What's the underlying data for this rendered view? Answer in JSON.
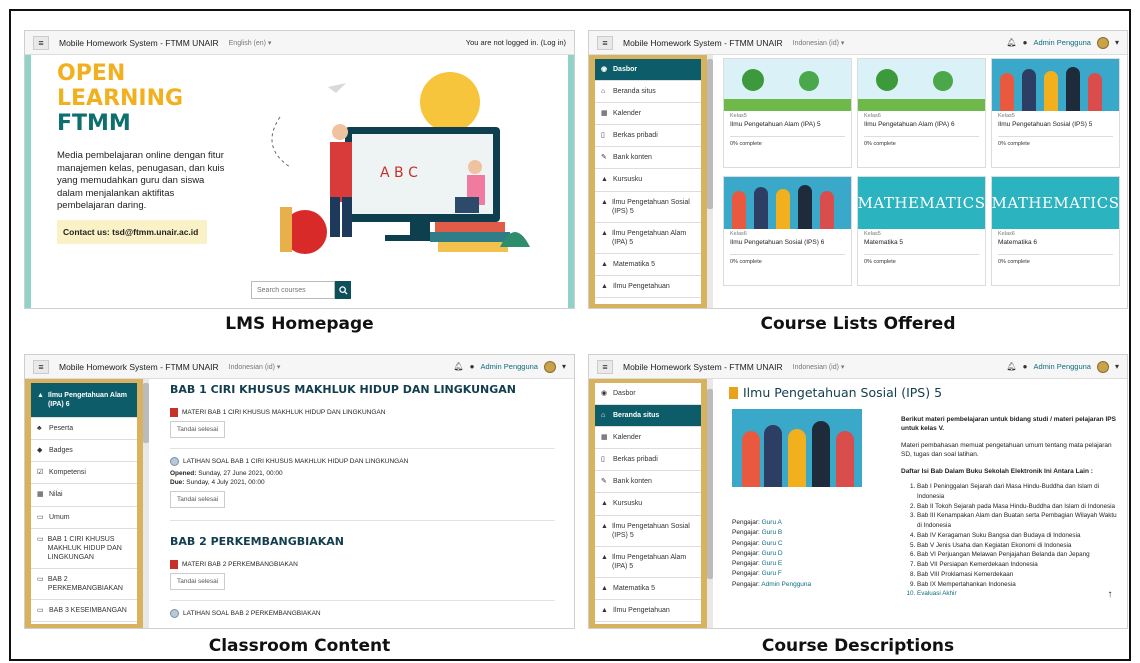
{
  "captions": {
    "homepage": "LMS Homepage",
    "course_lists": "Course Lists Offered",
    "classroom": "Classroom Content",
    "descriptions": "Course Descriptions"
  },
  "site_name": "Mobile Homework System - FTMM UNAIR",
  "homepage": {
    "lang": "English (en) ▾",
    "login_status": "You are not logged in. (Log in)",
    "hero_line1": "OPEN",
    "hero_line2": "LEARNING",
    "hero_line3": "FTMM",
    "description": "Media pembelajaran online dengan fitur manajemen kelas, penugasan, dan kuis yang memudahkan guru dan siswa dalam menjalankan aktifitas pembelajaran daring.",
    "contact": "Contact us: tsd@ftmm.unair.ac.id",
    "search_placeholder": "Search courses",
    "colors": {
      "hero_yellow": "#f2b01e",
      "hero_teal": "#0e6f6f",
      "accent_bar": "#8fd3c8",
      "search_btn": "#0d4f5a"
    }
  },
  "course_lists": {
    "lang": "Indonesian (id) ▾",
    "user": "Admin Pengguna",
    "sidebar": [
      {
        "label": "Dasbor",
        "icon": "dashboard-icon",
        "active": true
      },
      {
        "label": "Beranda situs",
        "icon": "home-icon",
        "active": false
      },
      {
        "label": "Kalender",
        "icon": "calendar-icon",
        "active": false
      },
      {
        "label": "Berkas pribadi",
        "icon": "file-icon",
        "active": false
      },
      {
        "label": "Bank konten",
        "icon": "brush-icon",
        "active": false
      },
      {
        "label": "Kursusku",
        "icon": "graduation-cap-icon",
        "active": false
      },
      {
        "label": "Ilmu Pengetahuan Sosial (IPS) 5",
        "icon": "graduation-cap-icon",
        "active": false
      },
      {
        "label": "Ilmu Pengetahuan Alam (IPA) 5",
        "icon": "graduation-cap-icon",
        "active": false
      },
      {
        "label": "Matematika 5",
        "icon": "graduation-cap-icon",
        "active": false
      },
      {
        "label": "Ilmu Pengetahuan",
        "icon": "graduation-cap-icon",
        "active": false
      }
    ],
    "cards": [
      {
        "category": "Kelas5",
        "title": "Ilmu Pengetahuan Alam (IPA) 5",
        "complete": "0% complete",
        "image": "trees"
      },
      {
        "category": "Kelas6",
        "title": "Ilmu Pengetahuan Alam (IPA) 6",
        "complete": "0% complete",
        "image": "trees"
      },
      {
        "category": "Kelas5",
        "title": "Ilmu Pengetahuan Sosial (IPS) 5",
        "complete": "0% complete",
        "image": "people"
      },
      {
        "category": "Kelas6",
        "title": "Ilmu Pengetahuan Sosial (IPS) 6",
        "complete": "0% complete",
        "image": "people"
      },
      {
        "category": "Kelas5",
        "title": "Matematika 5",
        "complete": "0% complete",
        "image": "math"
      },
      {
        "category": "Kelas6",
        "title": "Matematika 6",
        "complete": "0% complete",
        "image": "math"
      }
    ],
    "math_text": "MATHEMATICS"
  },
  "classroom": {
    "lang": "Indonesian (id) ▾",
    "user": "Admin Pengguna",
    "sidebar": [
      {
        "label": "Ilmu Pengetahuan Alam (IPA) 6",
        "icon": "graduation-cap-icon",
        "active": true
      },
      {
        "label": "Peserta",
        "icon": "users-icon",
        "active": false
      },
      {
        "label": "Badges",
        "icon": "badge-icon",
        "active": false
      },
      {
        "label": "Kompetensi",
        "icon": "check-icon",
        "active": false
      },
      {
        "label": "Nilai",
        "icon": "grid-icon",
        "active": false
      },
      {
        "label": "Umum",
        "icon": "folder-icon",
        "active": false
      },
      {
        "label": "BAB 1 CIRI KHUSUS MAKHLUK HIDUP DAN LINGKUNGAN",
        "icon": "folder-icon",
        "active": false
      },
      {
        "label": "BAB 2 PERKEMBANGBIAKAN",
        "icon": "folder-icon",
        "active": false
      },
      {
        "label": "BAB 3 KESEIMBANGAN",
        "icon": "folder-icon",
        "active": false
      }
    ],
    "section1_title": "BAB 1 CIRI KHUSUS MAKHLUK HIDUP DAN LINGKUNGAN",
    "section1_material": "MATERI BAB 1 CIRI KHUSUS MAKHLUK HIDUP DAN LINGKUNGAN",
    "section1_quiz": "LATIHAN SOAL BAB 1 CIRI KHUSUS MAKHLUK HIDUP DAN LINGKUNGAN",
    "opened_label": "Opened:",
    "opened_value": "Sunday, 27 June 2021, 00:00",
    "due_label": "Due:",
    "due_value": "Sunday, 4 July 2021, 00:00",
    "mark_done": "Tandai selesai",
    "section2_title": "BAB 2 PERKEMBANGBIAKAN",
    "section2_material": "MATERI BAB 2 PERKEMBANGBIAKAN",
    "section2_quiz": "LATIHAN SOAL BAB 2 PERKEMBANGBIAKAN"
  },
  "descriptions": {
    "lang": "Indonesian (id) ▾",
    "user": "Admin Pengguna",
    "sidebar": [
      {
        "label": "Dasbor",
        "icon": "dashboard-icon",
        "active": false
      },
      {
        "label": "Beranda situs",
        "icon": "home-icon",
        "active": true
      },
      {
        "label": "Kalender",
        "icon": "calendar-icon",
        "active": false
      },
      {
        "label": "Berkas pribadi",
        "icon": "file-icon",
        "active": false
      },
      {
        "label": "Bank konten",
        "icon": "brush-icon",
        "active": false
      },
      {
        "label": "Kursusku",
        "icon": "graduation-cap-icon",
        "active": false
      },
      {
        "label": "Ilmu Pengetahuan Sosial (IPS) 5",
        "icon": "graduation-cap-icon",
        "active": false
      },
      {
        "label": "Ilmu Pengetahuan Alam (IPA) 5",
        "icon": "graduation-cap-icon",
        "active": false
      },
      {
        "label": "Matematika 5",
        "icon": "graduation-cap-icon",
        "active": false
      },
      {
        "label": "Ilmu Pengetahuan",
        "icon": "graduation-cap-icon",
        "active": false
      }
    ],
    "course_title": "Ilmu Pengetahuan Sosial (IPS) 5",
    "intro_bold": "Berikut materi pembelajaran untuk bidang studi / materi pelajaran IPS untuk kelas V.",
    "intro_text": "Materi pembahasan memuat pengetahuan umum tentang mata pelajaran SD, tugas dan soal latihan.",
    "list_title": "Daftar Isi Bab Dalam Buku Sekolah Elektronik Ini Antara Lain :",
    "chapters": [
      "Bab I Peninggalan Sejarah dari Masa Hindu-Buddha dan Islam di Indonesia",
      "Bab II Tokoh Sejarah pada Masa Hindu-Buddha dan Islam di Indonesia",
      "Bab III Kenampakan Alam dan Buatan serta Pembagian Wilayah Waktu di Indonesia",
      "Bab IV Keragaman Suku Bangsa dan Budaya di Indonesia",
      "Bab V Jenis Usaha dan Kegiatan Ekonomi di Indonesia",
      "Bab VI Perjuangan Melawan Penjajahan Belanda dan Jepang",
      "Bab VII Persiapan Kemerdekaan Indonesia",
      "Bab VIII Proklamasi Kemerdekaan",
      "Bab IX Mempertahankan Indonesia",
      "Evaluasi Akhir"
    ],
    "teachers": [
      {
        "label": "Pengajar:",
        "name": "Guru A"
      },
      {
        "label": "Pengajar:",
        "name": "Guru B"
      },
      {
        "label": "Pengajar:",
        "name": "Guru C"
      },
      {
        "label": "Pengajar:",
        "name": "Guru D"
      },
      {
        "label": "Pengajar:",
        "name": "Guru E"
      },
      {
        "label": "Pengajar:",
        "name": "Guru F"
      },
      {
        "label": "Pengajar:",
        "name": "Admin Pengguna"
      }
    ],
    "back_to_top": "↑"
  }
}
